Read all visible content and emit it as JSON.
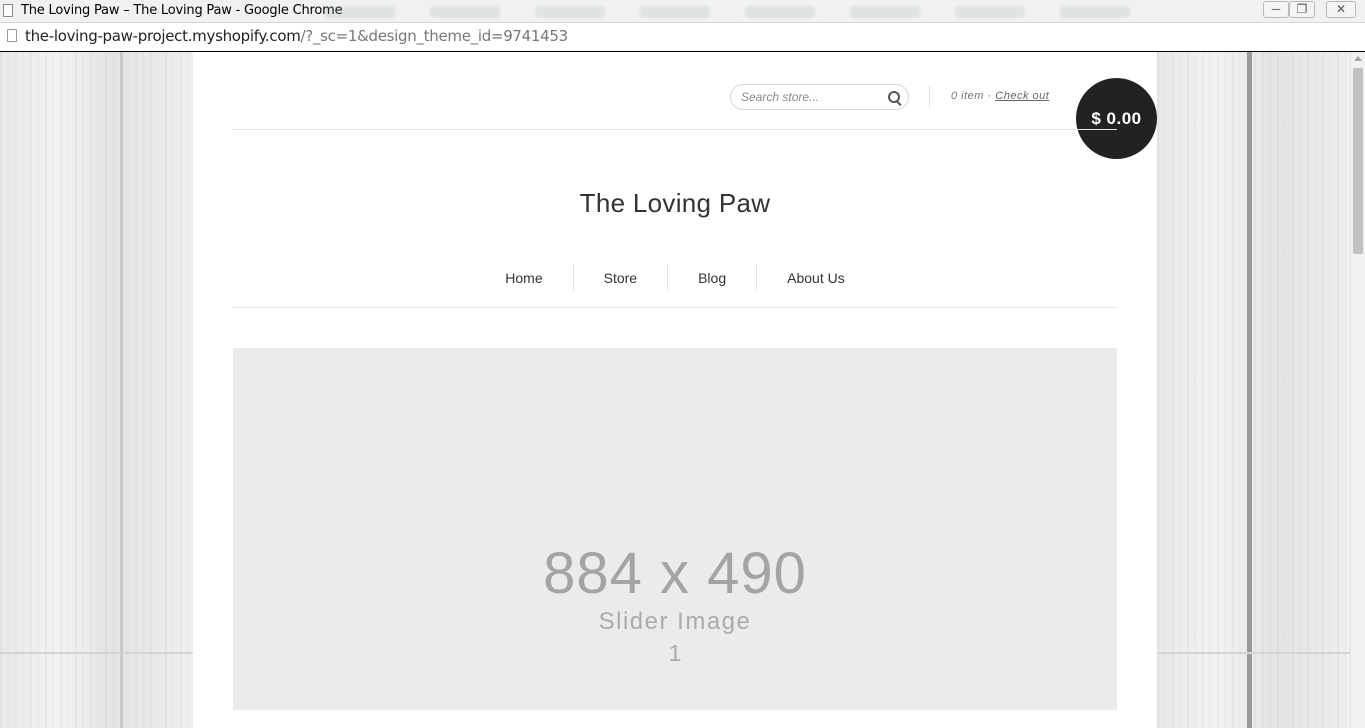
{
  "window": {
    "title": "The Loving Paw – The Loving Paw - Google Chrome"
  },
  "address": {
    "host": "the-loving-paw-project.myshopify.com",
    "path": "/?_sc=1&design_theme_id=9741453"
  },
  "header": {
    "search_placeholder": "Search store...",
    "cart_count": "0 item",
    "cart_separator": "·",
    "checkout_label": "Check out",
    "cart_total": "$ 0.00"
  },
  "store": {
    "title": "The Loving Paw"
  },
  "nav": {
    "items": [
      {
        "label": "Home"
      },
      {
        "label": "Store"
      },
      {
        "label": "Blog"
      },
      {
        "label": "About Us"
      }
    ]
  },
  "slider": {
    "dimensions": "884 x 490",
    "caption": "Slider Image",
    "index": "1"
  },
  "colors": {
    "cart_bubble": "#222222",
    "slider_bg": "#ebebeb",
    "accent_text": "#333333"
  }
}
